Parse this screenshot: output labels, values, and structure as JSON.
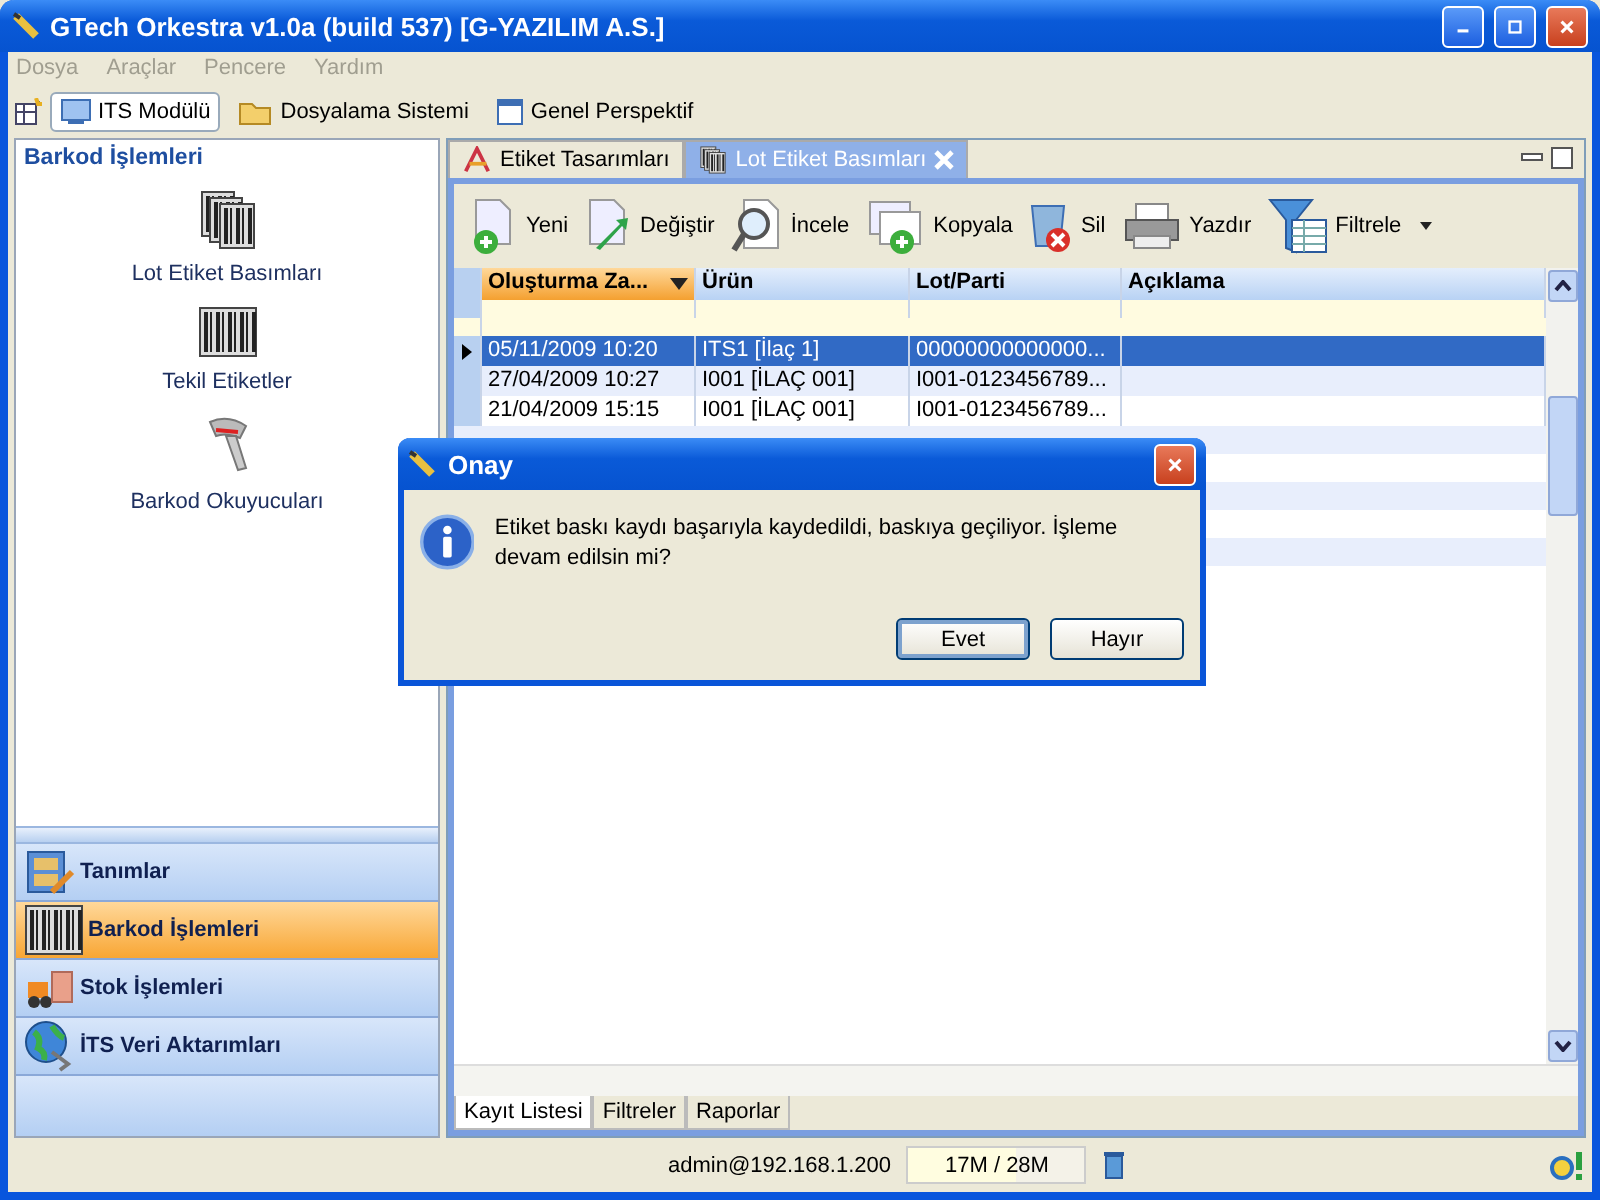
{
  "window": {
    "title": "GTech Orkestra v1.0a (build 537) [G-YAZILIM A.S.]"
  },
  "menu": [
    {
      "label": "Dosya",
      "disabled": true
    },
    {
      "label": "Araçlar",
      "disabled": true
    },
    {
      "label": "Pencere",
      "disabled": true
    },
    {
      "label": "Yardım",
      "disabled": true
    }
  ],
  "perspectives": [
    {
      "label": "ITS Modülü",
      "kind": "module",
      "selected": true
    },
    {
      "label": "Dosyalama Sistemi",
      "kind": "folder",
      "selected": false
    },
    {
      "label": "Genel Perspektif",
      "kind": "window",
      "selected": false
    }
  ],
  "navigator": {
    "title": "Barkod İşlemleri",
    "items": [
      {
        "label": "Lot Etiket Basımları",
        "kind": "barcodes"
      },
      {
        "label": "Tekil Etiketler",
        "kind": "barcode"
      },
      {
        "label": "Barkod Okuyucuları",
        "kind": "scanner"
      }
    ],
    "sections": [
      {
        "label": "Tanımlar",
        "kind": "cabinet",
        "selected": false
      },
      {
        "label": "Barkod İşlemleri",
        "kind": "barcode",
        "selected": true
      },
      {
        "label": "Stok İşlemleri",
        "kind": "forklift",
        "selected": false
      },
      {
        "label": "İTS Veri Aktarımları",
        "kind": "globe",
        "selected": false
      }
    ]
  },
  "editor_tabs": [
    {
      "label": "Etiket Tasarımları",
      "kind": "design",
      "selected": false,
      "closable": false
    },
    {
      "label": "Lot Etiket Basımları",
      "kind": "barcodes",
      "selected": true,
      "closable": true
    }
  ],
  "toolbar": [
    {
      "label": "Yeni",
      "kind": "new"
    },
    {
      "label": "Değiştir",
      "kind": "edit"
    },
    {
      "label": "İncele",
      "kind": "inspect"
    },
    {
      "label": "Kopyala",
      "kind": "copy"
    },
    {
      "label": "Sil",
      "kind": "delete"
    },
    {
      "label": "Yazdır",
      "kind": "print"
    },
    {
      "label": "Filtrele",
      "kind": "filter"
    }
  ],
  "table": {
    "columns": [
      {
        "label": "Oluşturma Za...",
        "sorted": true
      },
      {
        "label": "Ürün",
        "sorted": false
      },
      {
        "label": "Lot/Parti",
        "sorted": false
      },
      {
        "label": "Açıklama",
        "sorted": false
      }
    ],
    "rows": [
      {
        "cells": [
          "05/11/2009 10:20",
          "ITS1 [İlaç 1]",
          "00000000000000..."
        ],
        "selected": true
      },
      {
        "cells": [
          "27/04/2009 10:27",
          "I001 [İLAÇ 001]",
          "I001-0123456789..."
        ],
        "selected": false
      },
      {
        "cells": [
          "21/04/2009 15:15",
          "I001 [İLAÇ 001]",
          "I001-0123456789..."
        ],
        "selected": false
      }
    ]
  },
  "bottom_tabs": [
    {
      "label": "Kayıt Listesi",
      "selected": true
    },
    {
      "label": "Filtreler",
      "selected": false
    },
    {
      "label": "Raporlar",
      "selected": false
    }
  ],
  "status_bar": {
    "user": "admin@192.168.1.200",
    "memory": {
      "reading": "17M / 28M",
      "level": 0.61
    }
  },
  "dialog": {
    "title": "Onay",
    "message": "Etiket baskı kaydı başarıyla kaydedildi, baskıya geçiliyor. İşleme devam edilsin mi?",
    "buttons": [
      {
        "label": "Evet",
        "focused": true
      },
      {
        "label": "Hayır",
        "focused": false
      }
    ]
  }
}
